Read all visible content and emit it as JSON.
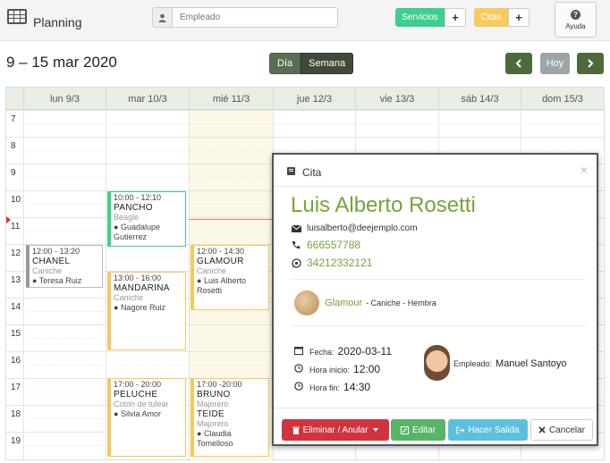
{
  "header": {
    "app_title": "Planning",
    "employee_placeholder": "Empleado",
    "servicios_label": "Servicios",
    "citas_label": "Citas",
    "plus_label": "+",
    "ayuda_label": "Ayuda",
    "colors": {
      "servicios": "#3ecf8e",
      "citas": "#f6cb5d"
    }
  },
  "toolbar": {
    "date_range": "9 – 15 mar 2020",
    "view_day": "Día",
    "view_week": "Semana",
    "today_label": "Hoy",
    "prev_icon": "chevron-left-icon",
    "next_icon": "chevron-right-icon"
  },
  "calendar": {
    "days": [
      "lun 9/3",
      "mar 10/3",
      "mié 11/3",
      "jue 12/3",
      "vie 13/3",
      "sáb 14/3",
      "dom 15/3"
    ],
    "hours": [
      "7",
      "8",
      "9",
      "10",
      "11",
      "12",
      "13",
      "14",
      "15",
      "16",
      "17",
      "18",
      "19"
    ],
    "events": [
      {
        "time": "10:00 - 12:10",
        "name": "PANCHO",
        "breed": "Beagle",
        "person": "Guadalupe Gutierrez",
        "color": "green"
      },
      {
        "time": "12:00 - 13:20",
        "name": "CHANEL",
        "breed": "Caniche",
        "person": "Teresa Ruiz",
        "color": "gray"
      },
      {
        "time": "13:00 - 16:00",
        "name": "MANDARINA",
        "breed": "Caniche",
        "person": "Nagore Ruiz",
        "color": "yellow"
      },
      {
        "time": "12:00 - 14:30",
        "name": "GLAMOUR",
        "breed": "Caniche",
        "person": "Luis Alberto Rosetti",
        "color": "yellow"
      },
      {
        "time": "17:00 - 20:00",
        "name": "PELUCHE",
        "breed": "Coton de tulear",
        "person": "Silvia Amor",
        "color": "yellow"
      },
      {
        "time": "17:00 -20:00",
        "name": "BRUNO",
        "breed": "Majorero",
        "name2": "TEIDE",
        "breed2": "Majorero",
        "person": "Claudia Tomelloso",
        "color": "yellow"
      }
    ]
  },
  "modal": {
    "title": "Cita",
    "close_label": "×",
    "client_name": "Luis Alberto Rosetti",
    "email": "luisalberto@deejemplo.com",
    "phone": "666557788",
    "whatsapp": "34212332121",
    "pet_name": "Glamour",
    "pet_info": "- Caniche - Hembra",
    "fecha_label": "Fecha:",
    "fecha_value": "2020-03-11",
    "inicio_label": "Hora inicio:",
    "inicio_value": "12:00",
    "fin_label": "Hora fin:",
    "fin_value": "14:30",
    "empleado_label": "Empleado:",
    "empleado_value": "Manuel Santoyo",
    "btn_delete": "Eliminar  /  Anular",
    "btn_edit": "Editar",
    "btn_exit": "Hacer Salida",
    "btn_cancel": "Cancelar"
  }
}
